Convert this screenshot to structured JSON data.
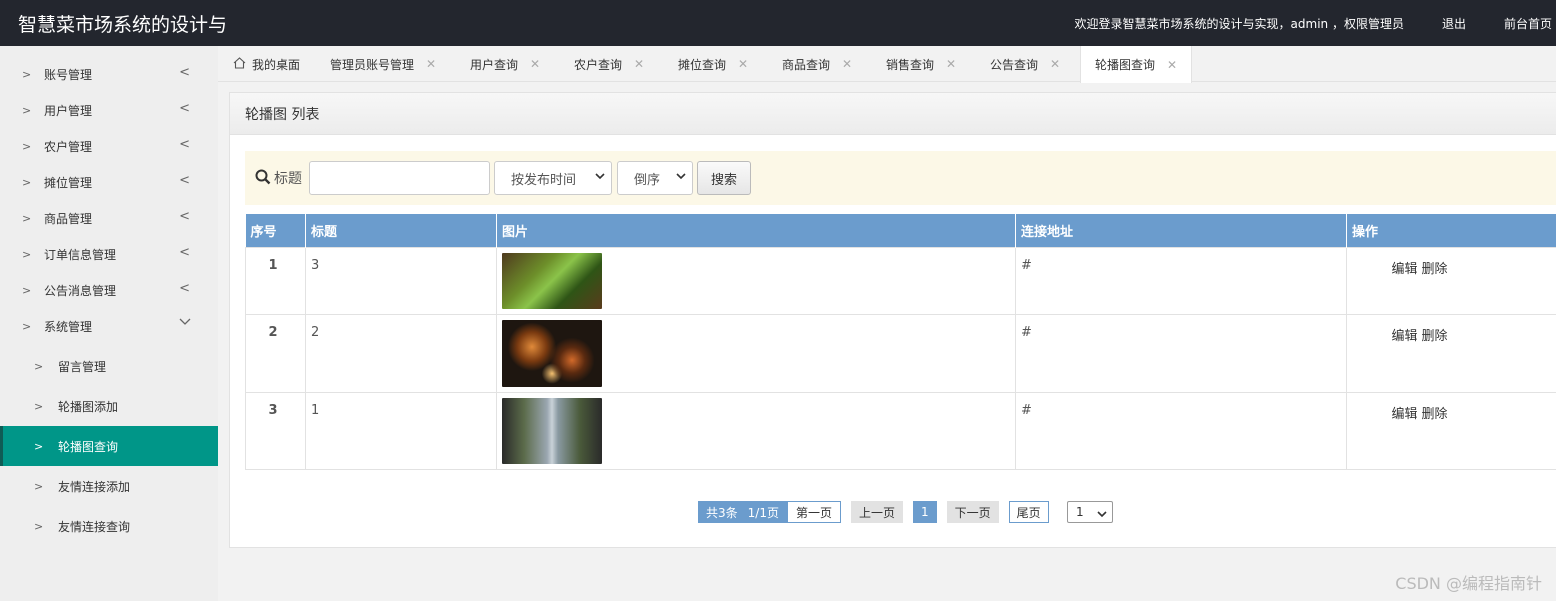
{
  "header": {
    "title": "智慧菜市场系统的设计与",
    "welcome": "欢迎登录智慧菜市场系统的设计与实现，admin ，权限管理员",
    "logout": "退出",
    "frontpage": "前台首页"
  },
  "sidebar": {
    "items": [
      {
        "label": "账号管理"
      },
      {
        "label": "用户管理"
      },
      {
        "label": "农户管理"
      },
      {
        "label": "摊位管理"
      },
      {
        "label": "商品管理"
      },
      {
        "label": "订单信息管理"
      },
      {
        "label": "公告消息管理"
      },
      {
        "label": "系统管理"
      }
    ],
    "sub_items": [
      {
        "label": "留言管理"
      },
      {
        "label": "轮播图添加"
      },
      {
        "label": "轮播图查询"
      },
      {
        "label": "友情连接添加"
      },
      {
        "label": "友情连接查询"
      }
    ]
  },
  "tabs": [
    {
      "label": "我的桌面"
    },
    {
      "label": "管理员账号管理"
    },
    {
      "label": "用户查询"
    },
    {
      "label": "农户查询"
    },
    {
      "label": "摊位查询"
    },
    {
      "label": "商品查询"
    },
    {
      "label": "销售查询"
    },
    {
      "label": "公告查询"
    },
    {
      "label": "轮播图查询"
    }
  ],
  "panel": {
    "title": "轮播图 列表"
  },
  "search": {
    "label": "标题",
    "value": "",
    "sort_field": "按发布时间",
    "sort_order": "倒序",
    "button": "搜索"
  },
  "table": {
    "headers": [
      "序号",
      "标题",
      "图片",
      "连接地址",
      "操作"
    ],
    "rows": [
      {
        "index": "1",
        "title": "3",
        "link": "#",
        "edit": "编辑",
        "delete": "删除"
      },
      {
        "index": "2",
        "title": "2",
        "link": "#",
        "edit": "编辑",
        "delete": "删除"
      },
      {
        "index": "3",
        "title": "1",
        "link": "#",
        "edit": "编辑",
        "delete": "删除"
      }
    ]
  },
  "pager": {
    "total": "共3条",
    "pages": "1/1页",
    "first": "第一页",
    "prev": "上一页",
    "current": "1",
    "next": "下一页",
    "last": "尾页",
    "jump_value": "1"
  },
  "watermark": "CSDN @编程指南针",
  "colors": {
    "header_bg": "#23262e",
    "active_nav": "#009688",
    "table_header": "#6b9ccd",
    "search_bg": "#fcf8e7"
  }
}
